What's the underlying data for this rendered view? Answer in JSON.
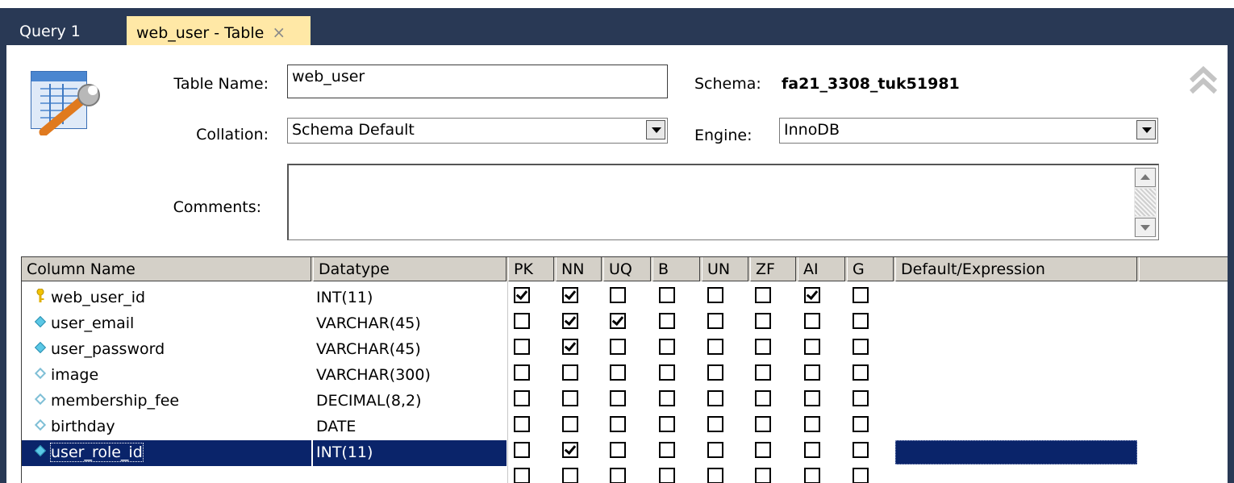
{
  "tabs": [
    {
      "label": "Query 1",
      "active": false
    },
    {
      "label": "web_user - Table",
      "active": true,
      "close_glyph": "×"
    }
  ],
  "form": {
    "table_name_label": "Table Name:",
    "table_name_value": "web_user",
    "schema_label": "Schema:",
    "schema_value": "fa21_3308_tuk51981",
    "collation_label": "Collation:",
    "collation_value": "Schema Default",
    "engine_label": "Engine:",
    "engine_value": "InnoDB",
    "comments_label": "Comments:",
    "comments_value": ""
  },
  "icons": {
    "table_icon": "table-edit-icon",
    "collapse": "double-chevron-up-icon"
  },
  "grid": {
    "headers": [
      "Column Name",
      "Datatype",
      "PK",
      "NN",
      "UQ",
      "B",
      "UN",
      "ZF",
      "AI",
      "G",
      "Default/Expression"
    ],
    "rows": [
      {
        "icon": "key",
        "name": "web_user_id",
        "type": "INT(11)",
        "flags": [
          1,
          1,
          0,
          0,
          0,
          0,
          1,
          0
        ]
      },
      {
        "icon": "diamond-filled",
        "name": "user_email",
        "type": "VARCHAR(45)",
        "flags": [
          0,
          1,
          1,
          0,
          0,
          0,
          0,
          0
        ]
      },
      {
        "icon": "diamond-filled",
        "name": "user_password",
        "type": "VARCHAR(45)",
        "flags": [
          0,
          1,
          0,
          0,
          0,
          0,
          0,
          0
        ]
      },
      {
        "icon": "diamond-hollow",
        "name": "image",
        "type": "VARCHAR(300)",
        "flags": [
          0,
          0,
          0,
          0,
          0,
          0,
          0,
          0
        ]
      },
      {
        "icon": "diamond-hollow",
        "name": "membership_fee",
        "type": "DECIMAL(8,2)",
        "flags": [
          0,
          0,
          0,
          0,
          0,
          0,
          0,
          0
        ]
      },
      {
        "icon": "diamond-hollow",
        "name": "birthday",
        "type": "DATE",
        "flags": [
          0,
          0,
          0,
          0,
          0,
          0,
          0,
          0
        ]
      },
      {
        "icon": "diamond-filled",
        "name": "user_role_id",
        "type": "INT(11)",
        "flags": [
          0,
          1,
          0,
          0,
          0,
          0,
          0,
          0
        ],
        "selected": true
      },
      {
        "icon": "none",
        "name": "",
        "type": "",
        "flags": [
          0,
          0,
          0,
          0,
          0,
          0,
          0,
          0
        ]
      }
    ]
  },
  "colors": {
    "frame": "#293955",
    "active_tab": "#ffe8a6",
    "selection": "#0a246a",
    "header_bg": "#d4d0c8"
  }
}
